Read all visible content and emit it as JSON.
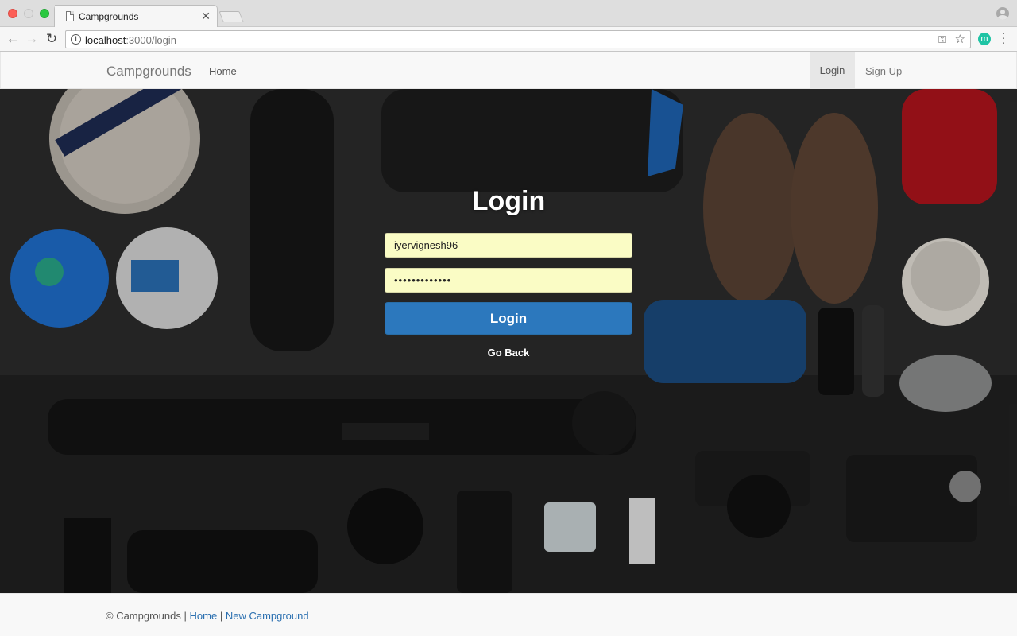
{
  "browser": {
    "tab_title": "Campgrounds",
    "url_host": "localhost",
    "url_path": ":3000/login",
    "icons": [
      "back-icon",
      "forward-icon",
      "reload-icon",
      "info-icon",
      "key-icon",
      "star-icon",
      "extension-icon",
      "menu-icon",
      "profile-icon"
    ],
    "extension_letter": "m"
  },
  "navbar": {
    "brand": "Campgrounds",
    "home": "Home",
    "login": "Login",
    "signup": "Sign Up"
  },
  "login_form": {
    "title": "Login",
    "username_value": "iyervignesh96",
    "password_value": "•••••••••••••",
    "submit_label": "Login",
    "go_back_label": "Go Back"
  },
  "footer": {
    "copyright": "© Campgrounds",
    "separator": "|",
    "home_link": "Home",
    "new_campground_link": "New Campground"
  },
  "colors": {
    "primary_button": "#2c78bd",
    "autofill_field": "#fafcc5",
    "link": "#2a6fb0"
  }
}
